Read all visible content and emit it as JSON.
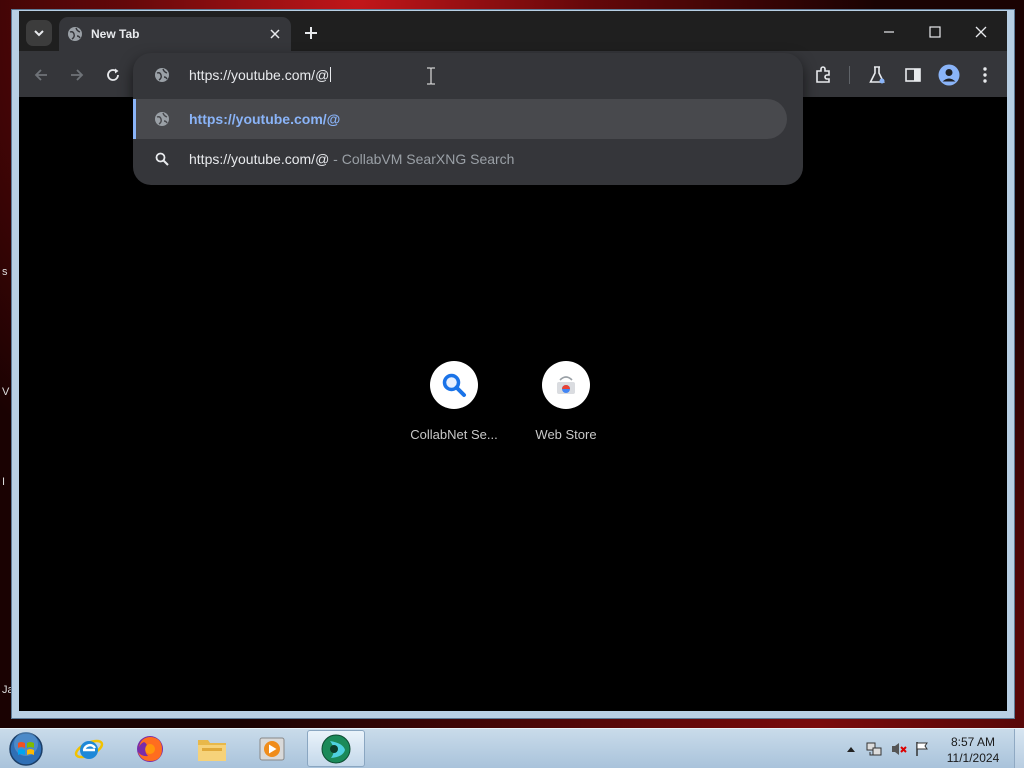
{
  "desktop": {
    "edge_fragments": [
      "s",
      "V",
      "I",
      "Ja"
    ]
  },
  "browser": {
    "tab": {
      "title": "New Tab",
      "icon": "globe-icon"
    },
    "window_controls": {
      "minimize": "minimize-icon",
      "maximize": "maximize-icon",
      "close": "close-icon"
    },
    "omnibox": {
      "value": "https://youtube.com/@",
      "suggestions": [
        {
          "icon": "globe-icon",
          "text": "https://youtube.com/@",
          "description": ""
        },
        {
          "icon": "search-icon",
          "text": "https://youtube.com/@",
          "description": " - CollabVM SearXNG Search"
        }
      ]
    },
    "toolbar_icons": [
      "extensions-icon",
      "labs-flask-icon",
      "side-panel-icon",
      "profile-icon",
      "menu-dots-icon"
    ],
    "shortcuts": [
      {
        "label": "CollabNet Se...",
        "icon": "magnifier-icon"
      },
      {
        "label": "Web Store",
        "icon": "web-store-icon"
      }
    ]
  },
  "taskbar": {
    "apps": [
      "internet-explorer-icon",
      "firefox-icon",
      "file-explorer-icon",
      "media-player-icon",
      "chrome-browser-icon"
    ],
    "clock": {
      "time": "8:57 AM",
      "date": "11/1/2024"
    }
  },
  "colors": {
    "accent": "#8ab4f8",
    "toolbar": "#35363a",
    "tabstrip": "#1f1f1f"
  }
}
